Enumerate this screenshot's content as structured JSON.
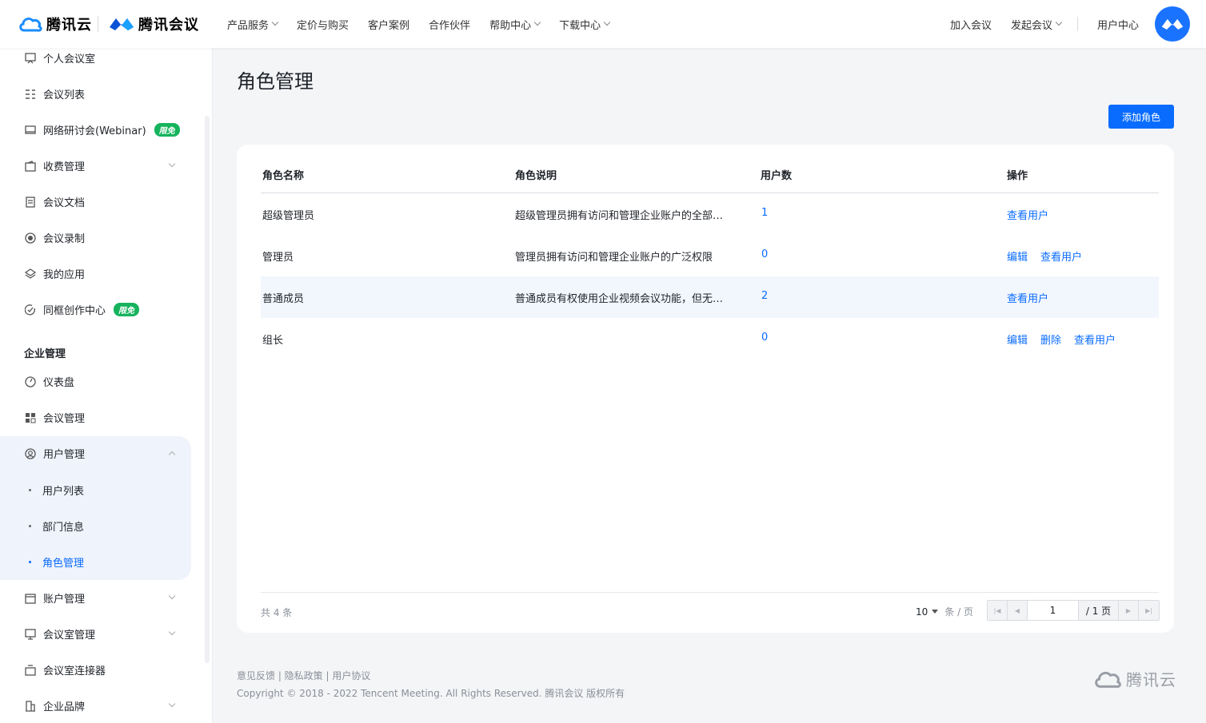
{
  "header": {
    "brand_cloud": "腾讯云",
    "brand_meeting": "腾讯会议",
    "nav": [
      {
        "label": "产品服务",
        "has_dropdown": true
      },
      {
        "label": "定价与购买",
        "has_dropdown": false
      },
      {
        "label": "客户案例",
        "has_dropdown": false
      },
      {
        "label": "合作伙伴",
        "has_dropdown": false
      },
      {
        "label": "帮助中心",
        "has_dropdown": true
      },
      {
        "label": "下载中心",
        "has_dropdown": true
      }
    ],
    "join_meeting": "加入会议",
    "start_meeting": "发起会议",
    "user_center": "用户中心",
    "brand_color": "#0a6cff"
  },
  "sidebar": {
    "items_top": [
      {
        "label": "个人会议室",
        "icon": "meeting-room-icon"
      },
      {
        "label": "会议列表",
        "icon": "list-icon"
      },
      {
        "label": "网络研讨会(Webinar)",
        "icon": "monitor-icon",
        "badge": "限免"
      },
      {
        "label": "收费管理",
        "icon": "wallet-icon",
        "expandable": true
      },
      {
        "label": "会议文档",
        "icon": "document-icon"
      },
      {
        "label": "会议录制",
        "icon": "record-icon"
      },
      {
        "label": "我的应用",
        "icon": "layers-icon"
      },
      {
        "label": "同框创作中心",
        "icon": "creation-icon",
        "badge": "限免"
      }
    ],
    "section_title": "企业管理",
    "dashboard": "仪表盘",
    "meeting_management": "会议管理",
    "user_management": "用户管理",
    "user_sub": [
      "用户列表",
      "部门信息",
      "角色管理"
    ],
    "items_bottom": [
      {
        "label": "账户管理",
        "icon": "account-icon",
        "expandable": true
      },
      {
        "label": "会议室管理",
        "icon": "room-manage-icon",
        "expandable": true
      },
      {
        "label": "会议室连接器",
        "icon": "connector-icon",
        "expandable": false
      },
      {
        "label": "企业品牌",
        "icon": "brand-icon",
        "expandable": true
      }
    ]
  },
  "main": {
    "title": "角色管理",
    "add_button": "添加角色",
    "columns": [
      "角色名称",
      "角色说明",
      "用户数",
      "操作"
    ],
    "rows": [
      {
        "name": "超级管理员",
        "desc": "超级管理员拥有访问和管理企业账户的全部…",
        "count": "1",
        "actions": [
          "查看用户"
        ]
      },
      {
        "name": "管理员",
        "desc": "管理员拥有访问和管理企业账户的广泛权限",
        "count": "0",
        "actions": [
          "编辑",
          "查看用户"
        ]
      },
      {
        "name": "普通成员",
        "desc": "普通成员有权使用企业视频会议功能，但无…",
        "count": "2",
        "actions": [
          "查看用户"
        ]
      },
      {
        "name": "组长",
        "desc": "",
        "count": "0",
        "actions": [
          "编辑",
          "删除",
          "查看用户"
        ]
      }
    ],
    "pagination": {
      "total_text": "共  4  条",
      "page_size": "10",
      "page_size_unit": "条 / 页",
      "current_page": "1",
      "total_pages": "/ 1 页"
    }
  },
  "footer": {
    "links": "意见反馈 | 隐私政策 | 用户协议",
    "copyright": "Copyright © 2018 - 2022 Tencent Meeting. All Rights Reserved. 腾讯会议 版权所有",
    "logo_text": "腾讯云"
  }
}
